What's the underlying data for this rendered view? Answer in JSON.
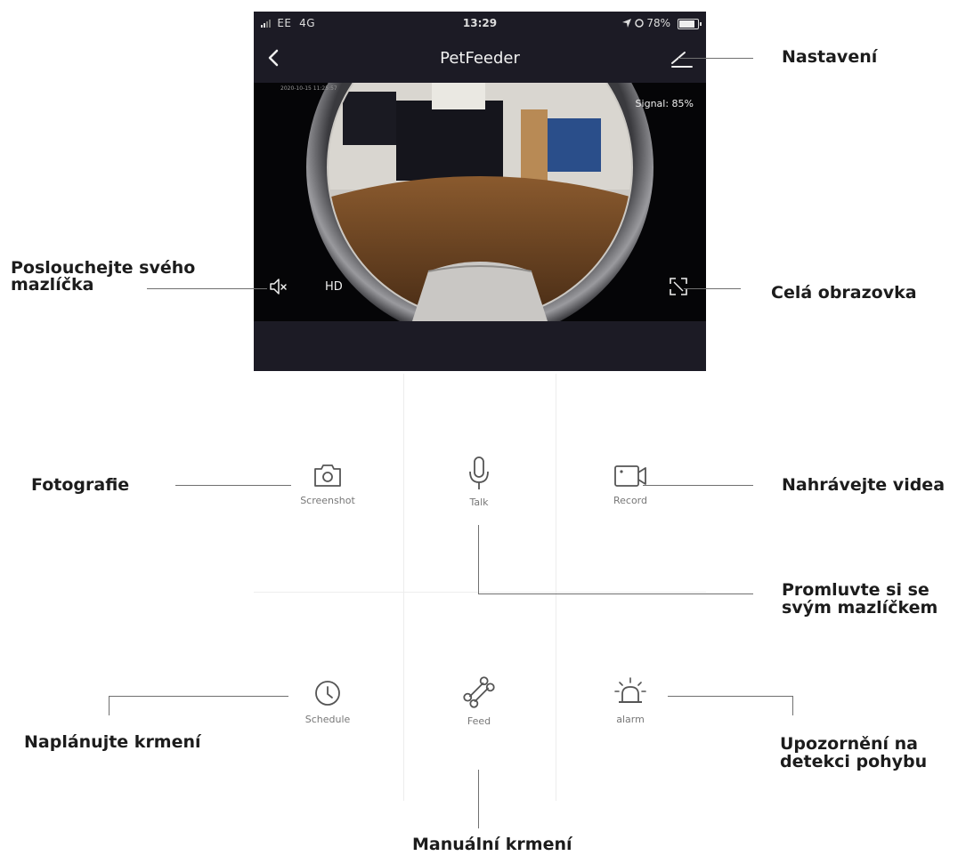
{
  "status_bar": {
    "carrier": "EE",
    "network": "4G",
    "time": "13:29",
    "battery": "78%"
  },
  "nav": {
    "title": "PetFeeder"
  },
  "video": {
    "signal": "Signal: 85%",
    "quality": "HD"
  },
  "controls": {
    "screenshot": "Screenshot",
    "talk": "Talk",
    "record": "Record",
    "schedule": "Schedule",
    "feed": "Feed",
    "alarm": "alarm"
  },
  "annotations": {
    "settings": "Nastavení",
    "listen_line1": "Poslouchejte svého",
    "listen_line2": "mazlíčka",
    "fullscreen": "Celá obrazovka",
    "photo": "Fotografie",
    "record_videos": "Nahrávejte videa",
    "talk_line1": "Promluvte si se",
    "talk_line2": "svým mazlíčkem",
    "schedule_feeding": "Naplánujte krmení",
    "motion_line1": "Upozornění na",
    "motion_line2": "detekci pohybu",
    "manual_feeding": "Manuální krmení"
  },
  "colors": {
    "phone_bg": "#1c1b25",
    "icon": "#555555",
    "annotation_line": "#707070"
  },
  "icons": [
    "back-chevron-icon",
    "settings-icon",
    "mute-speaker-icon",
    "fullscreen-icon",
    "camera-icon",
    "microphone-icon",
    "video-camera-icon",
    "clock-icon",
    "bone-icon",
    "alarm-light-icon"
  ]
}
